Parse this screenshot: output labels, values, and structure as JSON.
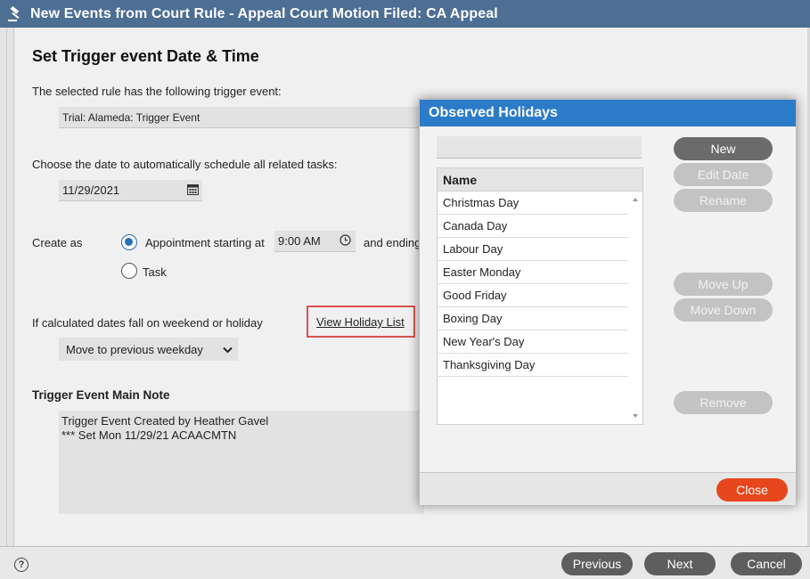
{
  "window": {
    "title": "New Events from Court Rule - Appeal Court Motion Filed: CA Appeal",
    "icon": "gavel-icon"
  },
  "form": {
    "heading": "Set Trigger event Date & Time",
    "trigger_label": "The selected rule has the following trigger event:",
    "trigger_value": "Trial: Alameda: Trigger Event",
    "date_label": "Choose the date to automatically schedule all related tasks:",
    "date_value": "11/29/2021",
    "create_as_label": "Create as",
    "appointment_label": "Appointment starting at",
    "time_value": "9:00 AM",
    "ending_label": "and ending",
    "task_label": "Task",
    "create_as_selected": "appointment",
    "weekend_label": "If calculated dates fall on weekend or holiday",
    "holiday_link": "View Holiday List",
    "weekend_option": "Move to previous weekday",
    "note_heading": "Trigger Event Main Note",
    "note_text": "Trigger Event Created by Heather Gavel\n*** Set Mon 11/29/21 ACAACMTN"
  },
  "footer": {
    "help_symbol": "?",
    "previous": "Previous",
    "next": "Next",
    "cancel": "Cancel"
  },
  "dialog": {
    "title": "Observed Holidays",
    "search_value": "",
    "column_header": "Name",
    "holidays": [
      "Christmas Day",
      "Canada Day",
      "Labour Day",
      "Easter Monday",
      "Good Friday",
      "Boxing Day",
      "New Year's Day",
      "Thanksgiving Day"
    ],
    "buttons": {
      "new": "New",
      "edit_date": "Edit Date",
      "rename": "Rename",
      "move_up": "Move Up",
      "move_down": "Move Down",
      "remove": "Remove",
      "close": "Close"
    }
  },
  "colors": {
    "titlebar": "#4d6f94",
    "dialog_title": "#2b7bc9",
    "radio_selected": "#2a6ebd",
    "close_button": "#e8461c",
    "highlight": "#d9534f"
  }
}
